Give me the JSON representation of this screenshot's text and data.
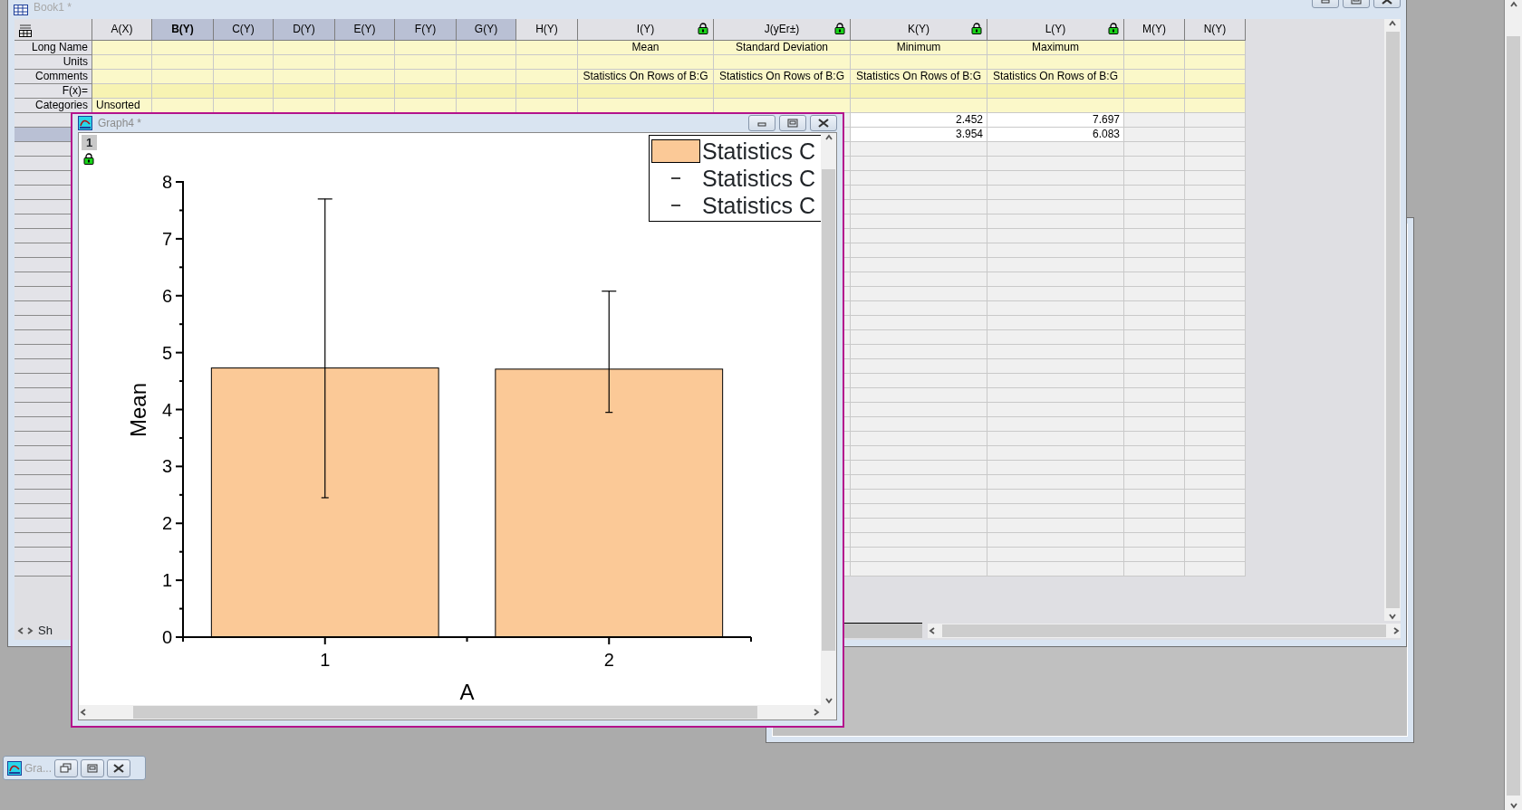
{
  "workbook": {
    "title": "Book1 *",
    "row_labels": [
      "Long Name",
      "Units",
      "Comments",
      "F(x)=",
      "Categories"
    ],
    "columns": [
      {
        "label": "A(X)",
        "selected": false,
        "current": false,
        "locked": false,
        "categories": "Unsorted"
      },
      {
        "label": "B(Y)",
        "selected": true,
        "current": true,
        "locked": false
      },
      {
        "label": "C(Y)",
        "selected": true,
        "current": false,
        "locked": false
      },
      {
        "label": "D(Y)",
        "selected": true,
        "current": false,
        "locked": false
      },
      {
        "label": "E(Y)",
        "selected": true,
        "current": false,
        "locked": false
      },
      {
        "label": "F(Y)",
        "selected": true,
        "current": false,
        "locked": false
      },
      {
        "label": "G(Y)",
        "selected": true,
        "current": false,
        "locked": false
      },
      {
        "label": "H(Y)",
        "selected": false,
        "current": false,
        "locked": false
      },
      {
        "label": "I(Y)",
        "selected": false,
        "current": false,
        "locked": true,
        "long_name": "Mean",
        "comments": "Statistics On Rows of B:G"
      },
      {
        "label": "J(yEr±)",
        "selected": false,
        "current": false,
        "locked": true,
        "long_name": "Standard Deviation",
        "comments": "Statistics On Rows of B:G"
      },
      {
        "label": "K(Y)",
        "selected": false,
        "current": false,
        "locked": true,
        "long_name": "Minimum",
        "comments": "Statistics On Rows of B:G",
        "values": [
          "2.452",
          "3.954"
        ]
      },
      {
        "label": "L(Y)",
        "selected": false,
        "current": false,
        "locked": true,
        "long_name": "Maximum",
        "comments": "Statistics On Rows of B:G",
        "values": [
          "7.697",
          "6.083"
        ]
      },
      {
        "label": "M(Y)",
        "selected": false,
        "current": false,
        "locked": false
      },
      {
        "label": "N(Y)",
        "selected": false,
        "current": false,
        "locked": false
      }
    ],
    "data_rows": [
      {
        "selected": false
      },
      {
        "selected": true
      }
    ],
    "sheet_tab": "Sh"
  },
  "graph_window": {
    "title": "Graph4 *",
    "layer": "1",
    "legend": [
      {
        "kind": "bar",
        "label": "Statistics C"
      },
      {
        "kind": "line",
        "label": "Statistics C"
      },
      {
        "kind": "line",
        "label": "Statistics C"
      }
    ],
    "chart_data": {
      "type": "bar",
      "xlabel": "A",
      "ylabel": "Mean",
      "categories": [
        "1",
        "2"
      ],
      "series": [
        {
          "color": "#fbc997",
          "values": [
            4.73,
            4.71
          ],
          "errors": [
            [
              2.45,
              7.7
            ],
            [
              3.95,
              6.08
            ]
          ]
        }
      ],
      "ylim": [
        0,
        8
      ],
      "yticks": [
        0,
        1,
        2,
        3,
        4,
        5,
        6,
        7,
        8
      ]
    }
  },
  "minimized_window": {
    "title": "Gra..."
  }
}
